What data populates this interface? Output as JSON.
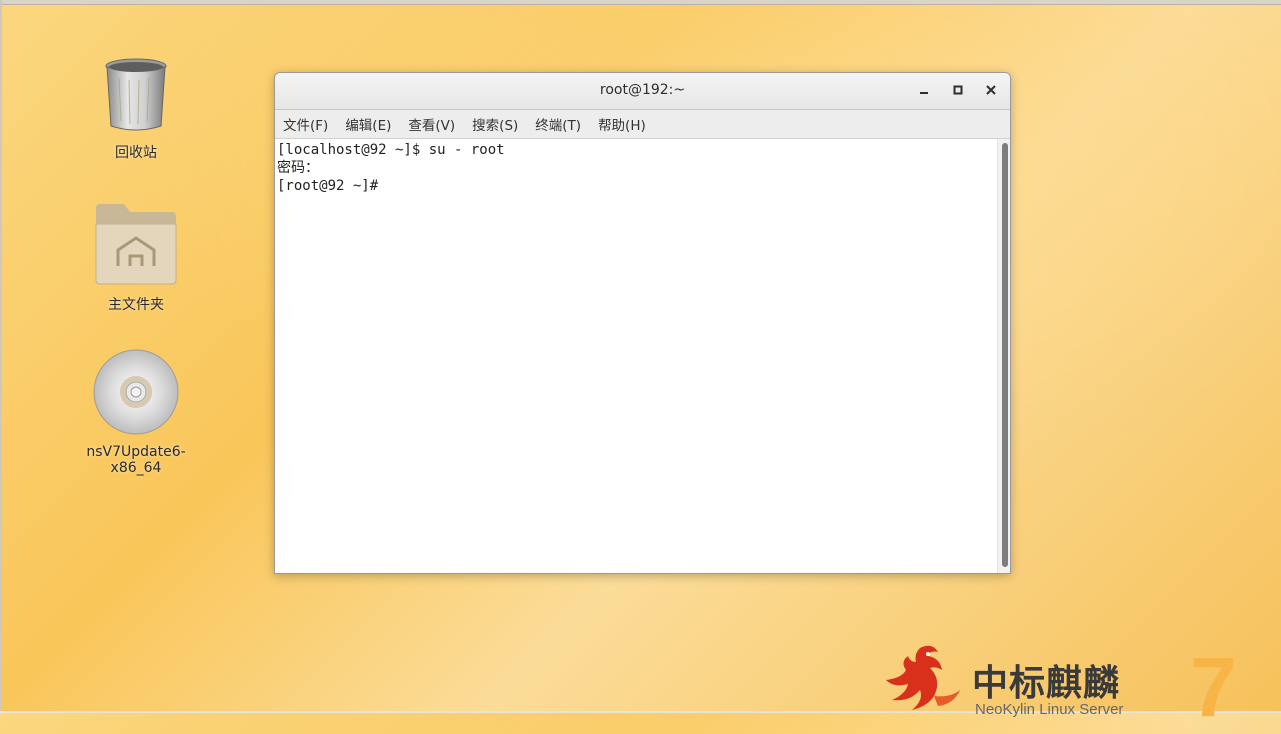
{
  "desktop": {
    "icons": [
      {
        "label": "回收站",
        "icon": "trash-icon"
      },
      {
        "label": "主文件夹",
        "icon": "home-folder-icon"
      },
      {
        "label": "nsV7Update6-x86_64",
        "icon": "disc-icon"
      }
    ]
  },
  "window": {
    "title": "root@192:~",
    "controls": {
      "minimize": "–",
      "maximize": "▫",
      "close": "✕"
    },
    "menu": [
      "文件(F)",
      "编辑(E)",
      "查看(V)",
      "搜索(S)",
      "终端(T)",
      "帮助(H)"
    ],
    "terminal_lines": [
      "[localhost@92 ~]$ su - root",
      "密码：",
      "[root@92 ~]#"
    ]
  },
  "branding": {
    "name": "中标麒麟",
    "subtitle": "NeoKylin Linux Server",
    "version": "7"
  },
  "colors": {
    "accent": "#f8b547",
    "logo_red": "#d9301c"
  }
}
